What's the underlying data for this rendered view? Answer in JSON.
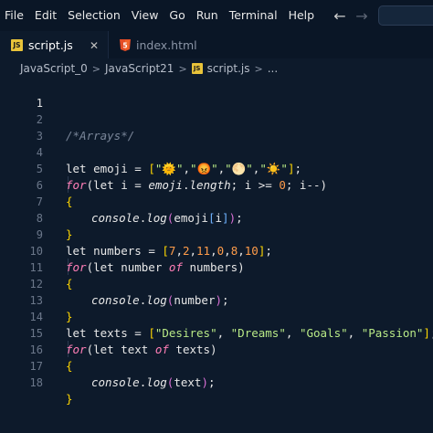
{
  "menu": [
    "File",
    "Edit",
    "Selection",
    "View",
    "Go",
    "Run",
    "Terminal",
    "Help"
  ],
  "nav": {
    "back": "←",
    "forward": "→"
  },
  "tabs": [
    {
      "label": "script.js",
      "badge": "JS",
      "close": "✕",
      "active": true
    },
    {
      "label": "index.html",
      "badge": "5",
      "active": false
    }
  ],
  "breadcrumb": {
    "items": [
      "JavaScript_0",
      "JavaScript21",
      "script.js",
      "..."
    ],
    "separator": ">",
    "file_badge": "JS"
  },
  "line_numbers": [
    "1",
    "2",
    "3",
    "4",
    "5",
    "6",
    "7",
    "8",
    "9",
    "10",
    "11",
    "12",
    "13",
    "14",
    "15",
    "16",
    "17",
    "18"
  ],
  "code": {
    "l2": "/*Arrays*/",
    "l4": {
      "let": "let",
      "name": "emoji",
      "eq": " = ",
      "open": "[",
      "items": [
        "\"🌞\"",
        "\"😡\"",
        "\"🌕\"",
        "\"☀️\""
      ],
      "close": "]",
      "semi": ";"
    },
    "l5": {
      "for": "for",
      "rest1": "(let i = ",
      "obj": "emoji",
      "dot": ".",
      "prop": "length",
      "rest2": "; i >= ",
      "zero": "0",
      "rest3": "; i--)"
    },
    "l6": "{",
    "l7": {
      "console": "console",
      "dot": ".",
      "log": "log",
      "open": "(",
      "arg": "emoji",
      "ob": "[",
      "idx": "i",
      "cb": "]",
      "close": ")",
      "semi": ";"
    },
    "l8": "}",
    "l9": {
      "let": "let",
      "name": "numbers",
      "eq": " = ",
      "open": "[",
      "vals": [
        "7",
        "2",
        "11",
        "0",
        "8",
        "10"
      ],
      "close": "]",
      "semi": ";"
    },
    "l10": {
      "for": "for",
      "rest1": "(let number ",
      "of": "of",
      "rest2": " numbers)"
    },
    "l11": "{",
    "l12": {
      "console": "console",
      "dot": ".",
      "log": "log",
      "open": "(",
      "arg": "number",
      "close": ")",
      "semi": ";"
    },
    "l13": "}",
    "l14": {
      "let": "let",
      "name": "texts",
      "eq": " = ",
      "open": "[",
      "items": [
        "\"Desires\"",
        "\"Dreams\"",
        "\"Goals\"",
        "\"Passion\""
      ],
      "close": "]",
      "semi": ";"
    },
    "l15": {
      "for": "for",
      "rest1": "(let text ",
      "of": "of",
      "rest2": " texts)"
    },
    "l16": "{",
    "l17": {
      "console": "console",
      "dot": ".",
      "log": "log",
      "open": "(",
      "arg": "text",
      "close": ")",
      "semi": ";"
    },
    "l18": "}"
  },
  "colors": {
    "background": "#0d1a2b",
    "keyword": "#ff7eb6",
    "string": "#b8e986",
    "number": "#ff9c4a",
    "comment": "#7a8699",
    "bracket": "#ffd700"
  }
}
